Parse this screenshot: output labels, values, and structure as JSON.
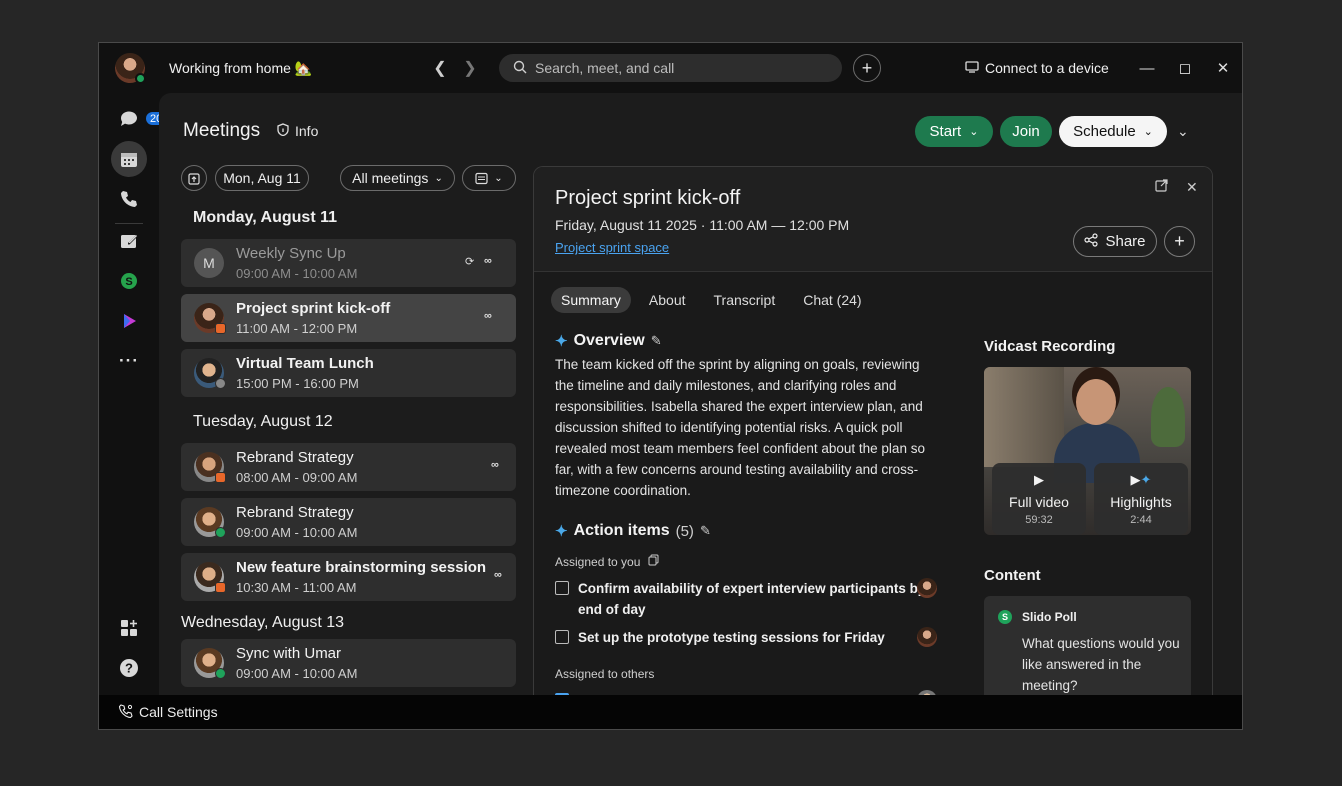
{
  "header": {
    "status": "Working from home 🏡",
    "search_placeholder": "Search, meet, and call",
    "connect_label": "Connect to a device"
  },
  "rail": {
    "messages_badge": "20"
  },
  "meetings": {
    "title": "Meetings",
    "info_label": "Info",
    "start_label": "Start",
    "join_label": "Join",
    "schedule_label": "Schedule",
    "date_button": "Mon, Aug 11",
    "filter_button": "All meetings"
  },
  "days": [
    {
      "heading": "Monday, August 11",
      "items": [
        {
          "title": "Weekly Sync Up",
          "time": "09:00 AM - 10:00 AM",
          "initial": "M"
        },
        {
          "title": "Project sprint kick-off",
          "time": "11:00 AM - 12:00 PM"
        },
        {
          "title": "Virtual Team Lunch",
          "time": "15:00 PM - 16:00 PM"
        }
      ]
    },
    {
      "heading": "Tuesday, August 12",
      "items": [
        {
          "title": "Rebrand Strategy",
          "time": "08:00 AM - 09:00 AM"
        },
        {
          "title": "Rebrand Strategy",
          "time": "09:00 AM - 10:00 AM"
        },
        {
          "title": "New feature brainstorming session",
          "time": "10:30 AM - 11:00 AM"
        }
      ]
    },
    {
      "heading": "Wednesday, August 13",
      "items": [
        {
          "title": "Sync with Umar",
          "time": "09:00 AM - 10:00 AM"
        }
      ]
    }
  ],
  "detail": {
    "title": "Project sprint kick-off",
    "date": "Friday, August 11 2025  ·  11:00 AM — 12:00 PM",
    "space_link": "Project sprint space",
    "share_label": "Share",
    "tabs": [
      "Summary",
      "About",
      "Transcript",
      "Chat (24)"
    ],
    "overview_title": "Overview",
    "overview_text": "The team kicked off the sprint by aligning on goals, reviewing the timeline and daily milestones, and clarifying roles and responsibilities. Isabella shared the expert interview plan, and discussion shifted to identifying potential risks. A quick poll revealed most team members feel confident about the plan so far, with a few concerns around testing availability and cross-timezone coordination.",
    "action_title": "Action items",
    "action_count": "(5)",
    "assigned_you": "Assigned to you",
    "action_items": [
      "Confirm availability of expert interview participants by end of day",
      "Set up the prototype testing sessions for Friday"
    ],
    "assigned_others": "Assigned to others",
    "recording_title": "Vidcast Recording",
    "full_video_label": "Full video",
    "full_video_duration": "59:32",
    "highlights_label": "Highlights",
    "highlights_duration": "2:44",
    "content_title": "Content",
    "slido_name": "Slido Poll",
    "slido_question": "What questions would you like answered in the meeting?"
  },
  "footer": {
    "call_settings": "Call Settings"
  },
  "colors": {
    "accent_green": "#1e7a4e",
    "link_blue": "#4aa3f0",
    "presence_green": "#1fa35b",
    "badge_blue": "#1a6fd9"
  }
}
